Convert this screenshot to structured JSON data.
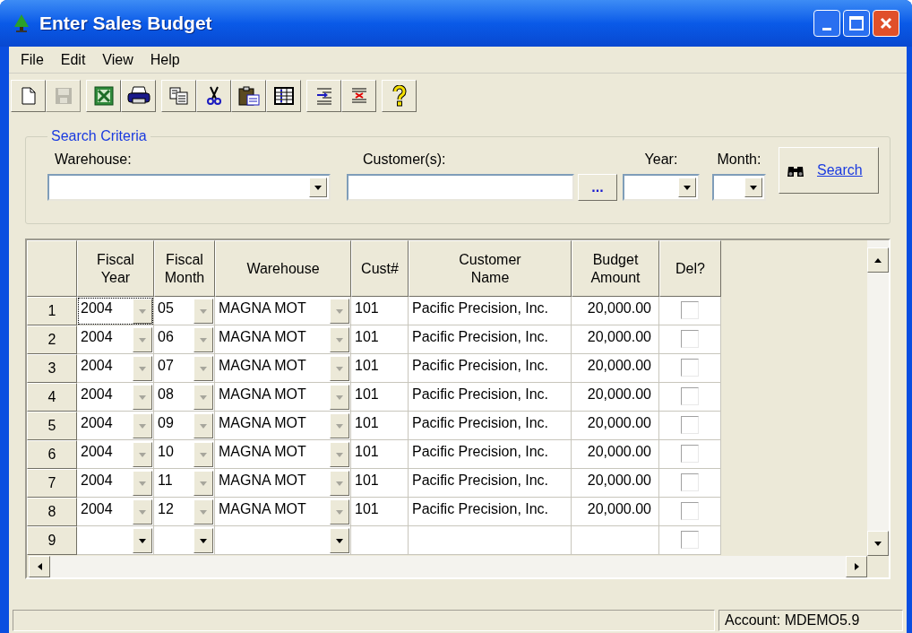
{
  "window": {
    "title": "Enter Sales Budget"
  },
  "menu": [
    "File",
    "Edit",
    "View",
    "Help"
  ],
  "toolbar_groups": [
    [
      {
        "kind": "new",
        "disabled": false
      },
      {
        "kind": "save",
        "disabled": true
      }
    ],
    [
      {
        "kind": "excel",
        "disabled": false
      },
      {
        "kind": "print",
        "disabled": false
      }
    ],
    [
      {
        "kind": "copy",
        "disabled": false
      },
      {
        "kind": "cut",
        "disabled": false
      },
      {
        "kind": "paste",
        "disabled": false
      },
      {
        "kind": "grid",
        "disabled": false
      }
    ],
    [
      {
        "kind": "insert",
        "disabled": false
      },
      {
        "kind": "delete",
        "disabled": false
      }
    ],
    [
      {
        "kind": "help",
        "disabled": false
      }
    ]
  ],
  "search_criteria": {
    "title": "Search Criteria",
    "warehouse_label": "Warehouse:",
    "customers_label": "Customer(s):",
    "browse_button": "...",
    "year_label": "Year:",
    "month_label": "Month:",
    "search_button": "Search"
  },
  "table": {
    "columns": [
      "Fiscal Year",
      "Fiscal Month",
      "Warehouse",
      "Cust#",
      "Customer Name",
      "Budget Amount",
      "Del?"
    ],
    "rows": [
      {
        "number": "1",
        "fiscal_year": "2004",
        "fiscal_month": "05",
        "warehouse": "MAGNA MOT",
        "cust": "101",
        "customer_name": "Pacific Precision, Inc.",
        "budget_amount": "20,000.00",
        "delete": false,
        "locked": true,
        "focused": true
      },
      {
        "number": "2",
        "fiscal_year": "2004",
        "fiscal_month": "06",
        "warehouse": "MAGNA MOT",
        "cust": "101",
        "customer_name": "Pacific Precision, Inc.",
        "budget_amount": "20,000.00",
        "delete": false,
        "locked": true,
        "focused": false
      },
      {
        "number": "3",
        "fiscal_year": "2004",
        "fiscal_month": "07",
        "warehouse": "MAGNA MOT",
        "cust": "101",
        "customer_name": "Pacific Precision, Inc.",
        "budget_amount": "20,000.00",
        "delete": false,
        "locked": true,
        "focused": false
      },
      {
        "number": "4",
        "fiscal_year": "2004",
        "fiscal_month": "08",
        "warehouse": "MAGNA MOT",
        "cust": "101",
        "customer_name": "Pacific Precision, Inc.",
        "budget_amount": "20,000.00",
        "delete": false,
        "locked": true,
        "focused": false
      },
      {
        "number": "5",
        "fiscal_year": "2004",
        "fiscal_month": "09",
        "warehouse": "MAGNA MOT",
        "cust": "101",
        "customer_name": "Pacific Precision, Inc.",
        "budget_amount": "20,000.00",
        "delete": false,
        "locked": true,
        "focused": false
      },
      {
        "number": "6",
        "fiscal_year": "2004",
        "fiscal_month": "10",
        "warehouse": "MAGNA MOT",
        "cust": "101",
        "customer_name": "Pacific Precision, Inc.",
        "budget_amount": "20,000.00",
        "delete": false,
        "locked": true,
        "focused": false
      },
      {
        "number": "7",
        "fiscal_year": "2004",
        "fiscal_month": "11",
        "warehouse": "MAGNA MOT",
        "cust": "101",
        "customer_name": "Pacific Precision, Inc.",
        "budget_amount": "20,000.00",
        "delete": false,
        "locked": true,
        "focused": false
      },
      {
        "number": "8",
        "fiscal_year": "2004",
        "fiscal_month": "12",
        "warehouse": "MAGNA MOT",
        "cust": "101",
        "customer_name": "Pacific Precision, Inc.",
        "budget_amount": "20,000.00",
        "delete": false,
        "locked": true,
        "focused": false
      },
      {
        "number": "9",
        "delete": false,
        "locked": false,
        "focused": false
      }
    ]
  },
  "status_bar": {
    "account": "Account: MDEMO5.9"
  }
}
